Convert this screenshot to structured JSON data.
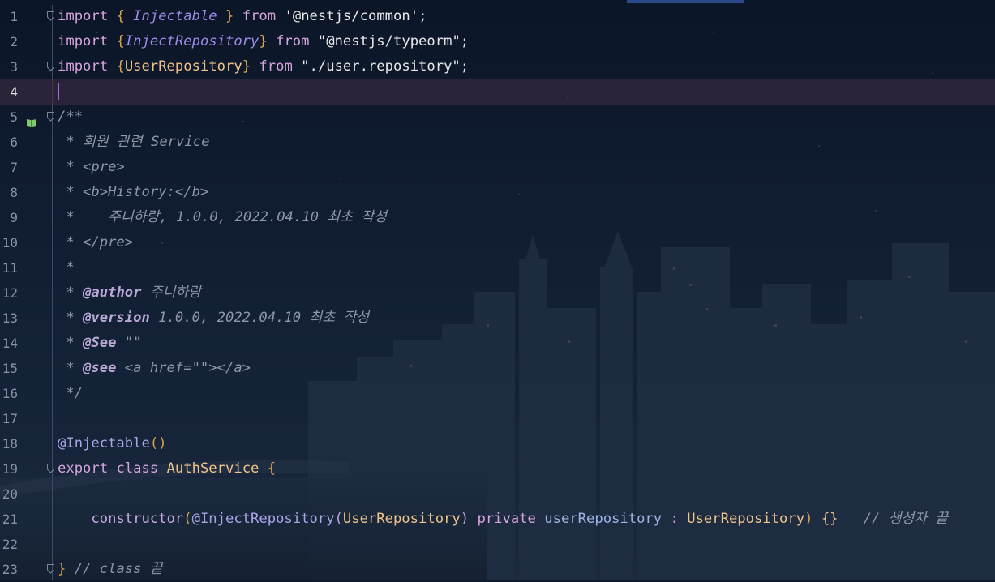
{
  "editor": {
    "lines": [
      {
        "n": "1",
        "tokens": [
          [
            "kw",
            "import"
          ],
          [
            "punc",
            " "
          ],
          [
            "brace",
            "{"
          ],
          [
            "punc",
            " "
          ],
          [
            "ityp",
            "Injectable"
          ],
          [
            "punc",
            " "
          ],
          [
            "brace",
            "}"
          ],
          [
            "punc",
            " "
          ],
          [
            "kw",
            "from"
          ],
          [
            "punc",
            " "
          ],
          [
            "str",
            "'@nestjs/common'"
          ],
          [
            "punc",
            ";"
          ]
        ]
      },
      {
        "n": "2",
        "tokens": [
          [
            "kw",
            "import"
          ],
          [
            "punc",
            " "
          ],
          [
            "brace",
            "{"
          ],
          [
            "ityp",
            "InjectRepository"
          ],
          [
            "brace",
            "}"
          ],
          [
            "punc",
            " "
          ],
          [
            "kw",
            "from"
          ],
          [
            "punc",
            " "
          ],
          [
            "str",
            "\"@nestjs/typeorm\""
          ],
          [
            "punc",
            ";"
          ]
        ]
      },
      {
        "n": "3",
        "tokens": [
          [
            "kw",
            "import"
          ],
          [
            "punc",
            " "
          ],
          [
            "brace",
            "{"
          ],
          [
            "type",
            "UserRepository"
          ],
          [
            "brace",
            "}"
          ],
          [
            "punc",
            " "
          ],
          [
            "kw",
            "from"
          ],
          [
            "punc",
            " "
          ],
          [
            "str",
            "\"./user.repository\""
          ],
          [
            "punc",
            ";"
          ]
        ]
      },
      {
        "n": "4",
        "tokens": []
      },
      {
        "n": "5",
        "tokens": [
          [
            "comment",
            "/**"
          ]
        ]
      },
      {
        "n": "6",
        "tokens": [
          [
            "comment",
            " * 회원 관련 Service"
          ]
        ]
      },
      {
        "n": "7",
        "tokens": [
          [
            "comment",
            " * <pre>"
          ]
        ]
      },
      {
        "n": "8",
        "tokens": [
          [
            "comment",
            " * <b>History:</b>"
          ]
        ]
      },
      {
        "n": "9",
        "tokens": [
          [
            "comment",
            " *    주니하랑, 1.0.0, 2022.04.10 최초 작성"
          ]
        ]
      },
      {
        "n": "10",
        "tokens": [
          [
            "comment",
            " * </pre>"
          ]
        ]
      },
      {
        "n": "11",
        "tokens": [
          [
            "comment",
            " *"
          ]
        ]
      },
      {
        "n": "12",
        "tokens": [
          [
            "comment",
            " * "
          ],
          [
            "tag",
            "@author"
          ],
          [
            "comment",
            " 주니하랑"
          ]
        ]
      },
      {
        "n": "13",
        "tokens": [
          [
            "comment",
            " * "
          ],
          [
            "tag",
            "@version"
          ],
          [
            "comment",
            " 1.0.0, 2022.04.10 최초 작성"
          ]
        ]
      },
      {
        "n": "14",
        "tokens": [
          [
            "comment",
            " * "
          ],
          [
            "tag",
            "@See"
          ],
          [
            "comment",
            " \"\""
          ]
        ]
      },
      {
        "n": "15",
        "tokens": [
          [
            "comment",
            " * "
          ],
          [
            "tag",
            "@see"
          ],
          [
            "comment",
            " <a href=\"\"></a>"
          ]
        ]
      },
      {
        "n": "16",
        "tokens": [
          [
            "comment",
            " */"
          ]
        ]
      },
      {
        "n": "17",
        "tokens": []
      },
      {
        "n": "18",
        "tokens": [
          [
            "deco",
            "@Injectable"
          ],
          [
            "brace",
            "()"
          ]
        ]
      },
      {
        "n": "19",
        "tokens": [
          [
            "kw",
            "export"
          ],
          [
            "punc",
            " "
          ],
          [
            "kw",
            "class"
          ],
          [
            "punc",
            " "
          ],
          [
            "type",
            "AuthService"
          ],
          [
            "punc",
            " "
          ],
          [
            "brace",
            "{"
          ]
        ]
      },
      {
        "n": "20",
        "tokens": []
      },
      {
        "n": "21",
        "tokens": [
          [
            "punc",
            "    "
          ],
          [
            "ctor",
            "constructor"
          ],
          [
            "brace",
            "("
          ],
          [
            "deco",
            "@InjectRepository"
          ],
          [
            "brace2",
            "("
          ],
          [
            "type",
            "UserRepository"
          ],
          [
            "brace2",
            ")"
          ],
          [
            "punc",
            " "
          ],
          [
            "kw",
            "private"
          ],
          [
            "punc",
            " "
          ],
          [
            "field",
            "userRepository"
          ],
          [
            "punc",
            " "
          ],
          [
            "kw",
            ":"
          ],
          [
            "punc",
            " "
          ],
          [
            "type",
            "UserRepository"
          ],
          [
            "brace",
            ")"
          ],
          [
            "punc",
            " "
          ],
          [
            "type",
            "{}"
          ],
          [
            "punc",
            "   "
          ],
          [
            "comment",
            "// 생성자 끝"
          ]
        ]
      },
      {
        "n": "22",
        "tokens": []
      },
      {
        "n": "23",
        "tokens": [
          [
            "brace",
            "}"
          ],
          [
            "punc",
            " "
          ],
          [
            "comment",
            "// class 끝"
          ]
        ]
      }
    ],
    "current_line": "4",
    "fold_lines": [
      "1",
      "3",
      "5",
      "19",
      "23"
    ],
    "bookmark_line": "5"
  }
}
